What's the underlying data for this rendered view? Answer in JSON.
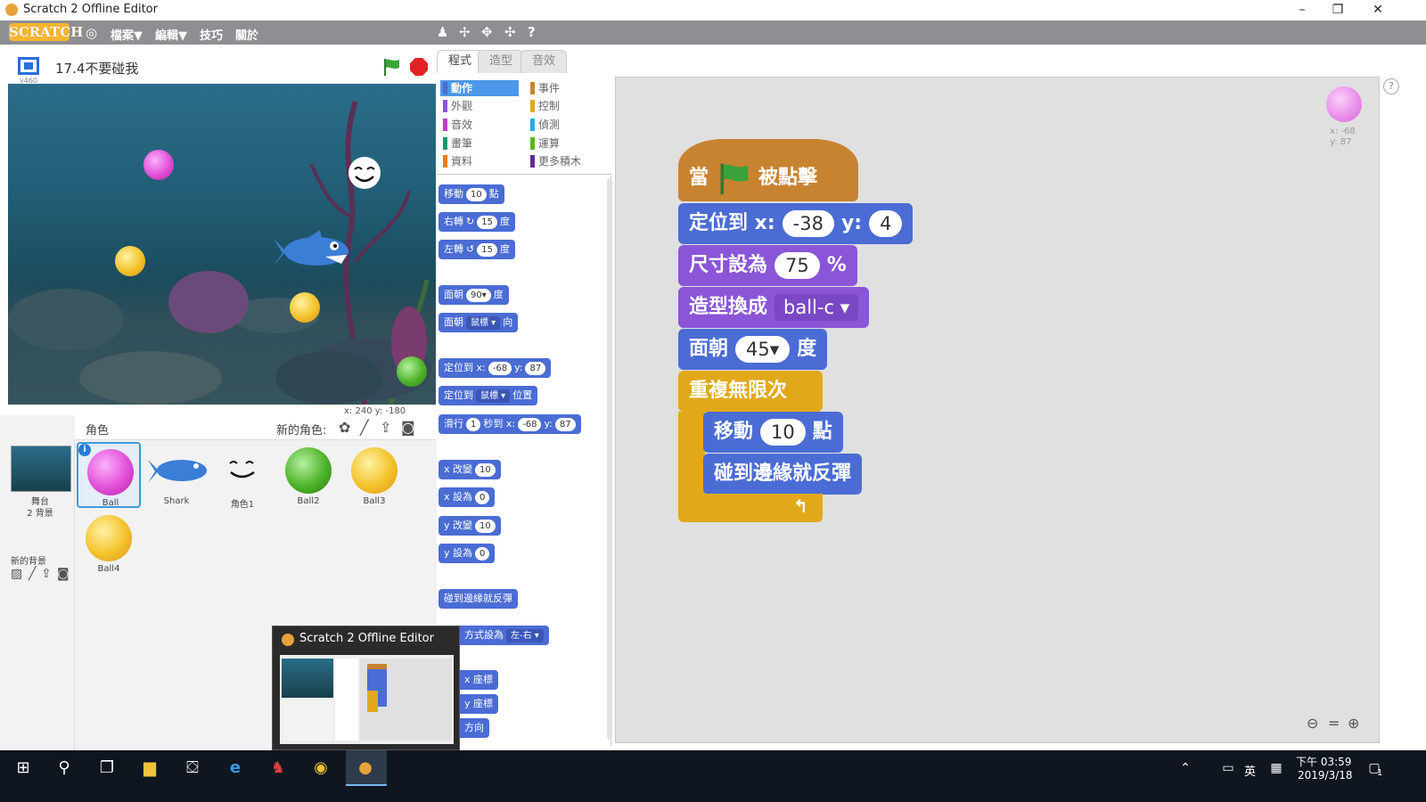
{
  "window": {
    "title": "Scratch 2 Offline Editor",
    "minimize": "–",
    "maximize": "❐",
    "close": "✕"
  },
  "menubar": {
    "logo": "SCRATCH",
    "file": "檔案▼",
    "edit": "編輯▼",
    "tips": "技巧",
    "about": "關於"
  },
  "stage_header": {
    "version": "v460",
    "project_title": "17.4不要碰我"
  },
  "stage": {
    "coords": "x: 240   y: -180"
  },
  "sprite_pane": {
    "sprites_label": "角色",
    "new_sprite_label": "新的角色:",
    "stage_label": "舞台",
    "backdrops_count": "2 背景",
    "new_backdrop_label": "新的背景",
    "info_badge": "i",
    "sprites": [
      {
        "name": "Ball",
        "color": "#e24fd8"
      },
      {
        "name": "Shark",
        "color": "#3a7ed6"
      },
      {
        "name": "角色1",
        "color": "#ffffff"
      },
      {
        "name": "Ball2",
        "color": "#4db32a"
      },
      {
        "name": "Ball3",
        "color": "#f4c22a"
      },
      {
        "name": "Ball4",
        "color": "#f4c22a"
      }
    ]
  },
  "tabs": [
    "程式",
    "造型",
    "音效"
  ],
  "categories": [
    {
      "label": "動作",
      "color": "#4a6cd4"
    },
    {
      "label": "事件",
      "color": "#c88330"
    },
    {
      "label": "外觀",
      "color": "#8a55d7"
    },
    {
      "label": "控制",
      "color": "#e1a91a"
    },
    {
      "label": "音效",
      "color": "#bb42c3"
    },
    {
      "label": "偵測",
      "color": "#2ca5e2"
    },
    {
      "label": "畫筆",
      "color": "#0e9a6c"
    },
    {
      "label": "運算",
      "color": "#5cb712"
    },
    {
      "label": "資料",
      "color": "#ee7d16"
    },
    {
      "label": "更多積木",
      "color": "#632d99"
    }
  ],
  "palette": {
    "move": {
      "a": "移動",
      "v": "10",
      "b": "點"
    },
    "turn_right": {
      "a": "右轉",
      "v": "15",
      "b": "度"
    },
    "turn_left": {
      "a": "左轉",
      "v": "15",
      "b": "度"
    },
    "point_dir": {
      "a": "面朝",
      "v": "90▾",
      "b": "度"
    },
    "point_towards": {
      "a": "面朝",
      "v": "鼠標 ▾",
      "b": "向"
    },
    "goto_xy": {
      "a": "定位到 x:",
      "x": "-68",
      "m": "y:",
      "y": "87"
    },
    "goto_target": {
      "a": "定位到",
      "v": "鼠標 ▾",
      "b": "位置"
    },
    "glide": {
      "a": "滑行",
      "s": "1",
      "m": "秒到 x:",
      "x": "-68",
      "n": "y:",
      "y": "87"
    },
    "change_x": {
      "a": "x 改變",
      "v": "10"
    },
    "set_x": {
      "a": "x 設為",
      "v": "0"
    },
    "change_y": {
      "a": "y 改變",
      "v": "10"
    },
    "set_y": {
      "a": "y 設為",
      "v": "0"
    },
    "bounce": "碰到邊緣就反彈",
    "rotation_style": {
      "a": "方式設為",
      "v": "左-右 ▾"
    },
    "x_pos": "x 座標",
    "y_pos": "y 座標",
    "direction": "方向"
  },
  "sprite_info": {
    "x": "x: -68",
    "y": "y: 87"
  },
  "script": {
    "hat": {
      "a": "當",
      "b": "被點擊"
    },
    "goto": {
      "a": "定位到 x:",
      "x": "-38",
      "m": "y:",
      "y": "4"
    },
    "size": {
      "a": "尺寸設為",
      "v": "75",
      "b": "%"
    },
    "costume": {
      "a": "造型換成",
      "v": "ball-c ▾"
    },
    "point": {
      "a": "面朝",
      "v": "45▾",
      "b": "度"
    },
    "forever": "重複無限次",
    "move": {
      "a": "移動",
      "v": "10",
      "b": "點"
    },
    "bounce": "碰到邊緣就反彈"
  },
  "taskbar_preview": {
    "title": "Scratch 2 Offline Editor"
  },
  "taskbar": {
    "ime": "英",
    "time": "下午 03:59",
    "date": "2019/3/18",
    "notifications": "1"
  }
}
